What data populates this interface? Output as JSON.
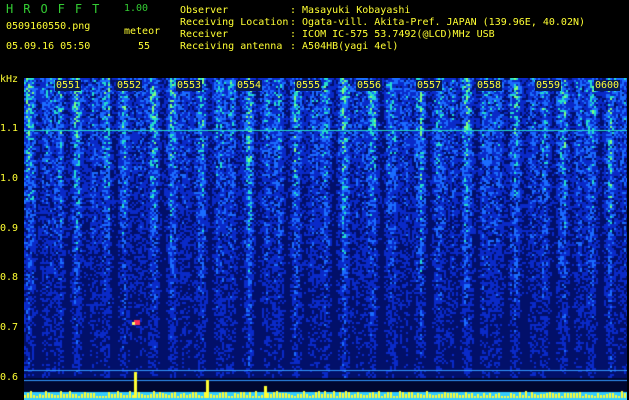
{
  "header": {
    "app_name": "HROFFT",
    "version": "1.00",
    "filename": "0509160550.png",
    "datetime": "05.09.16 05:50",
    "meteor_label": "meteor",
    "meteor_count": "55"
  },
  "info": {
    "observer_label": "Observer",
    "observer_value": ": Masayuki Kobayashi",
    "location_label": "Receiving Location",
    "location_value": ": Ogata-vill. Akita-Pref. JAPAN (139.96E, 40.02N)",
    "receiver_label": "Receiver",
    "receiver_value": ": ICOM IC-575 53.7492(@LCD)MHz USB",
    "antenna_label": "Receiving antenna",
    "antenna_value": ": A504HB(yagi 4el)"
  },
  "spectrogram": {
    "y_unit": "kHz",
    "y_ticks": [
      "1.1",
      "1.0",
      "0.9",
      "0.8",
      "0.7",
      "0.6"
    ],
    "x_ticks": [
      "0551",
      "0552",
      "0553",
      "0554",
      "0555",
      "0556",
      "0557",
      "0558",
      "0559",
      "0600"
    ],
    "colors": {
      "low": "#000a60",
      "mid": "#1a4cff",
      "high": "#33ffcc",
      "peak": "#ffff33",
      "meteor": "#ff3355",
      "baseline": "#33ccff"
    }
  }
}
